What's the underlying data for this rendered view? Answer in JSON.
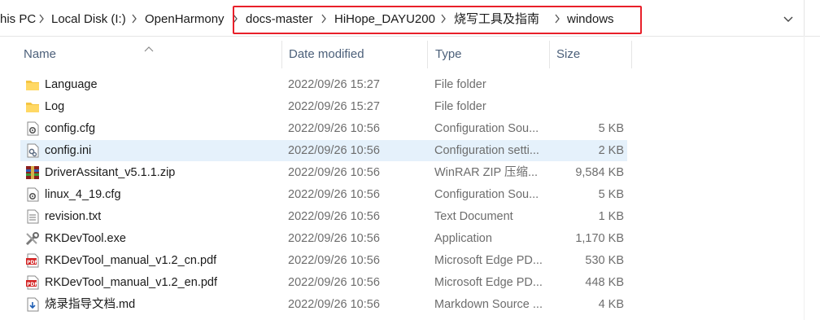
{
  "breadcrumb": [
    "his PC",
    "Local Disk (I:)",
    "OpenHarmony",
    "docs-master",
    "HiHope_DAYU200",
    "烧写工具及指南",
    "windows"
  ],
  "columns": {
    "name": "Name",
    "date": "Date modified",
    "type": "Type",
    "size": "Size"
  },
  "files": [
    {
      "name": "Language",
      "date": "2022/09/26 15:27",
      "type": "File folder",
      "size": "",
      "icon": "folder-icon"
    },
    {
      "name": "Log",
      "date": "2022/09/26 15:27",
      "type": "File folder",
      "size": "",
      "icon": "folder-icon"
    },
    {
      "name": "config.cfg",
      "date": "2022/09/26 10:56",
      "type": "Configuration Sou...",
      "size": "5 KB",
      "icon": "config-file-icon"
    },
    {
      "name": "config.ini",
      "date": "2022/09/26 10:56",
      "type": "Configuration setti...",
      "size": "2 KB",
      "icon": "settings-file-icon",
      "selected": true
    },
    {
      "name": "DriverAssitant_v5.1.1.zip",
      "date": "2022/09/26 10:56",
      "type": "WinRAR ZIP 压缩...",
      "size": "9,584 KB",
      "icon": "winrar-archive-icon"
    },
    {
      "name": "linux_4_19.cfg",
      "date": "2022/09/26 10:56",
      "type": "Configuration Sou...",
      "size": "5 KB",
      "icon": "config-file-icon"
    },
    {
      "name": "revision.txt",
      "date": "2022/09/26 10:56",
      "type": "Text Document",
      "size": "1 KB",
      "icon": "text-file-icon"
    },
    {
      "name": "RKDevTool.exe",
      "date": "2022/09/26 10:56",
      "type": "Application",
      "size": "1,170 KB",
      "icon": "tools-app-icon"
    },
    {
      "name": "RKDevTool_manual_v1.2_cn.pdf",
      "date": "2022/09/26 10:56",
      "type": "Microsoft Edge PD...",
      "size": "530 KB",
      "icon": "pdf-file-icon"
    },
    {
      "name": "RKDevTool_manual_v1.2_en.pdf",
      "date": "2022/09/26 10:56",
      "type": "Microsoft Edge PD...",
      "size": "448 KB",
      "icon": "pdf-file-icon"
    },
    {
      "name": "烧录指导文档.md",
      "date": "2022/09/26 10:56",
      "type": "Markdown Source ...",
      "size": "4 KB",
      "icon": "markdown-file-icon"
    }
  ],
  "colors": {
    "highlight_border": "#e8202a",
    "selection": "#e5f1fb",
    "header_text": "#4c607a",
    "folder": "#f5c542"
  }
}
